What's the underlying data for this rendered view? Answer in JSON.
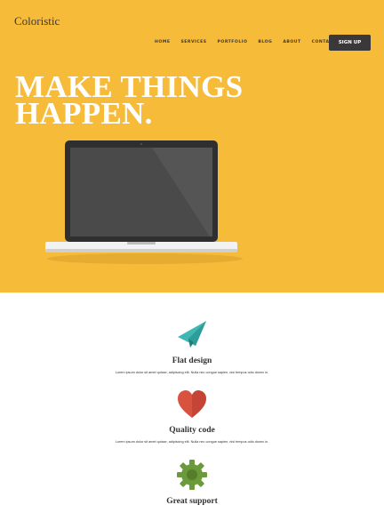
{
  "site": {
    "logo": "Coloristic"
  },
  "nav": {
    "items": [
      "HOME",
      "SERVICES",
      "PORTFOLIO",
      "BLOG",
      "ABOUT",
      "CONTACT"
    ],
    "signup_label": "SIGN UP"
  },
  "hero": {
    "headline_line1": "MAKE THINGS",
    "headline_line2": "HAPPEN.",
    "background": "#f7bb3a"
  },
  "features": [
    {
      "icon": "paper-plane-icon",
      "title": "Flat design",
      "text": "Lorem ipsum dolor sit amet quisse, adipiscing elit. Nulla nec congue sapien, nisi tempus odio donec in."
    },
    {
      "icon": "heart-icon",
      "title": "Quality code",
      "text": "Lorem ipsum dolor sit amet quisse, adipiscing elit. Nulla nec congue sapien, nisi tempus odio donec in."
    },
    {
      "icon": "gear-icon",
      "title": "Great support",
      "text": ""
    }
  ],
  "colors": {
    "accent": "#f7bb3a",
    "dark": "#3a3838",
    "plane": "#3fb8b4",
    "heart": "#d9513f",
    "gear": "#6a9a3a"
  }
}
